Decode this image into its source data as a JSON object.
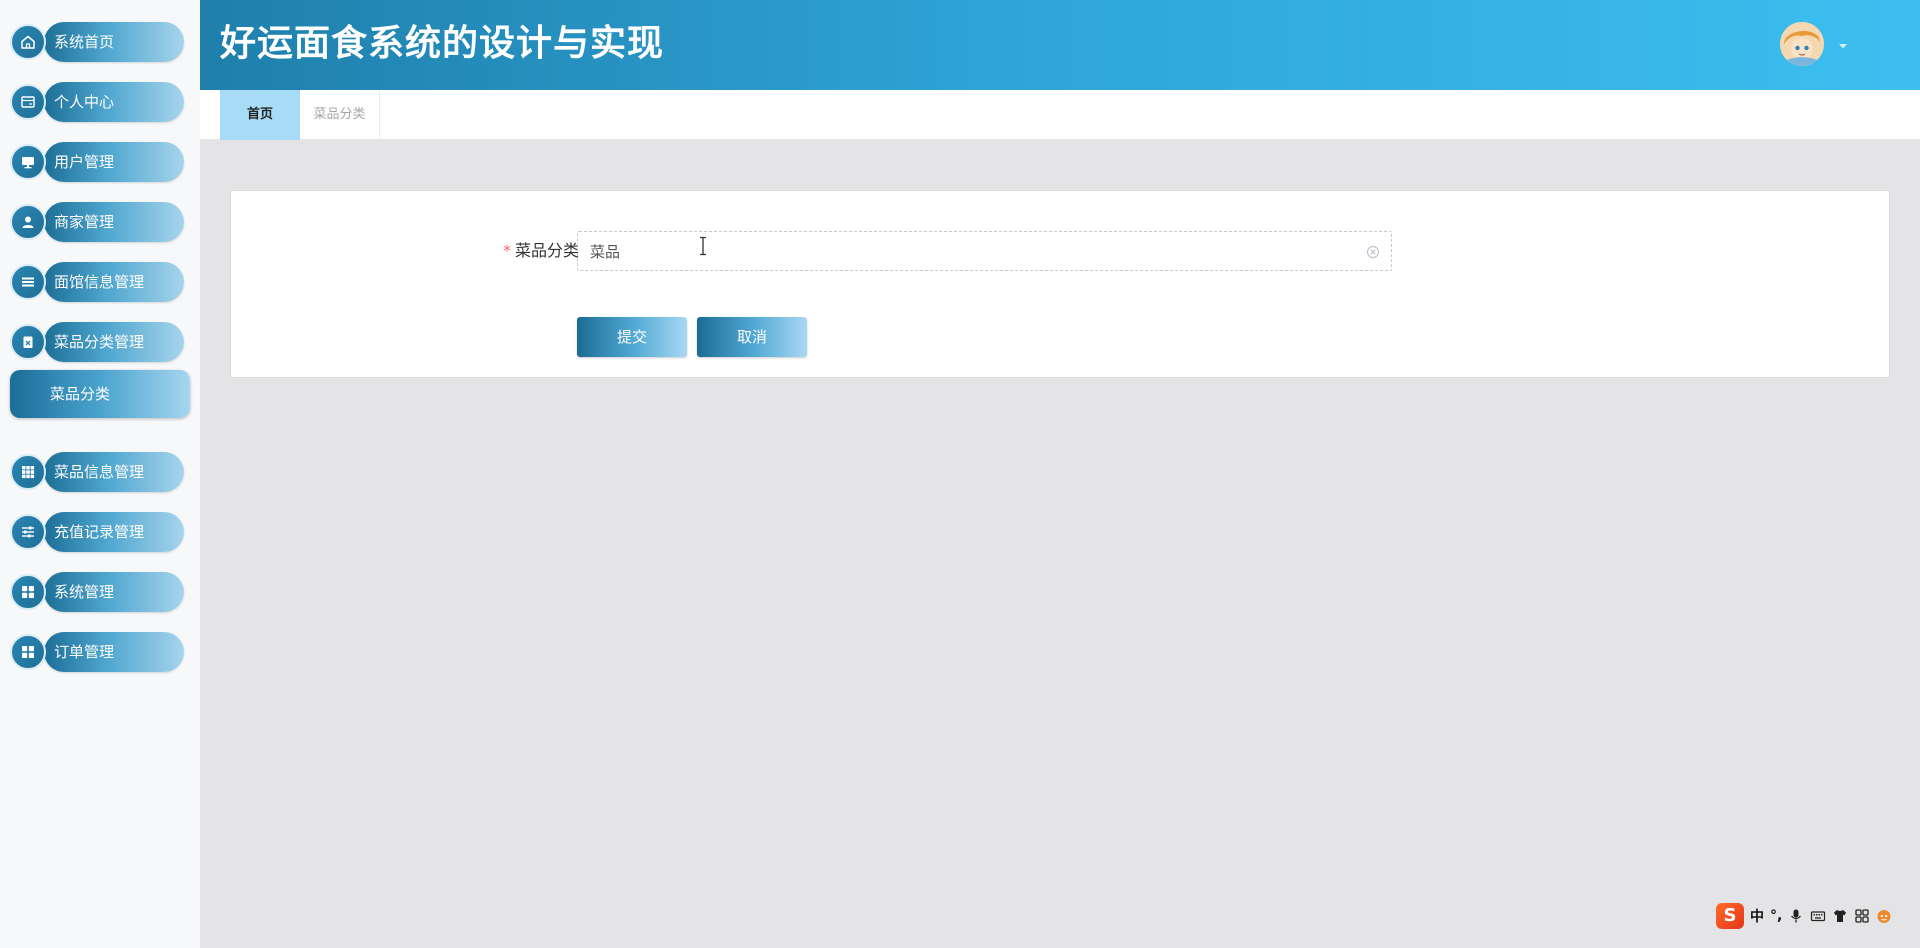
{
  "app": {
    "title": "好运面食系统的设计与实现"
  },
  "colors": {
    "header_start": "#1f7fab",
    "header_end": "#3cbff0",
    "accent": "#2a86b2",
    "tab_active_bg": "#a8dcf6",
    "required_star": "#f56c6c",
    "page_bg": "#e4e4e6"
  },
  "sidebar": {
    "items": [
      {
        "label": "系统首页",
        "icon": "home-icon"
      },
      {
        "label": "个人中心",
        "icon": "id-card-icon"
      },
      {
        "label": "用户管理",
        "icon": "monitor-icon"
      },
      {
        "label": "商家管理",
        "icon": "user-icon"
      },
      {
        "label": "面馆信息管理",
        "icon": "list-icon"
      },
      {
        "label": "菜品分类管理",
        "icon": "clipboard-icon"
      },
      {
        "label": "菜品信息管理",
        "icon": "grid-icon"
      },
      {
        "label": "充值记录管理",
        "icon": "sliders-icon"
      },
      {
        "label": "系统管理",
        "icon": "apps-icon"
      },
      {
        "label": "订单管理",
        "icon": "apps-icon"
      }
    ],
    "submenu": {
      "label": "菜品分类",
      "parent": "菜品分类管理"
    }
  },
  "header": {
    "avatar": "avatar-icon",
    "dropdown": "caret-down-icon"
  },
  "tabs": [
    {
      "label": "首页",
      "active": true
    },
    {
      "label": "菜品分类",
      "active": false
    }
  ],
  "form": {
    "category_label": "菜品分类",
    "required_mark": "*",
    "category_value": "菜品",
    "submit_label": "提交",
    "cancel_label": "取消"
  },
  "ime": {
    "logo_letter": "S",
    "mode_text": "中",
    "punct_text": "°,"
  }
}
